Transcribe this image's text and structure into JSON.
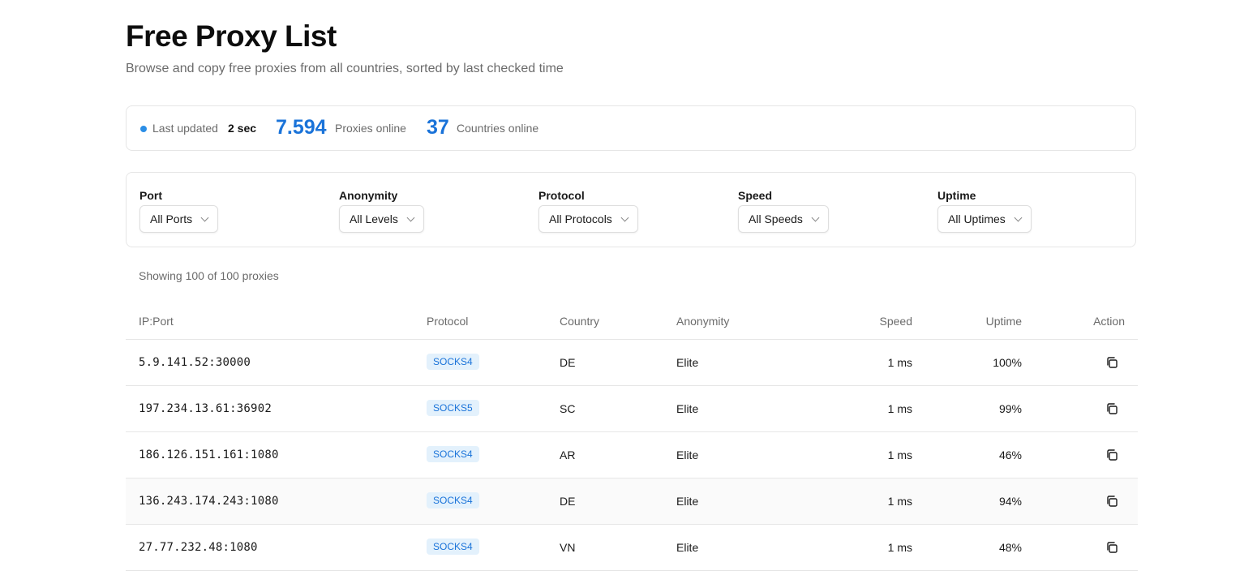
{
  "header": {
    "title": "Free Proxy List",
    "subtitle": "Browse and copy free proxies from all countries, sorted by last checked time"
  },
  "stats": {
    "last_updated_label": "Last updated",
    "last_updated_value": "2 sec",
    "proxies_count": "7.594",
    "proxies_label": "Proxies online",
    "countries_count": "37",
    "countries_label": "Countries online",
    "status_dot_color": "#2b8ee6"
  },
  "filters": {
    "port": {
      "label": "Port",
      "value": "All Ports"
    },
    "anonymity": {
      "label": "Anonymity",
      "value": "All Levels"
    },
    "protocol": {
      "label": "Protocol",
      "value": "All Protocols"
    },
    "speed": {
      "label": "Speed",
      "value": "All Speeds"
    },
    "uptime": {
      "label": "Uptime",
      "value": "All Uptimes"
    }
  },
  "showing_text": "Showing 100 of 100 proxies",
  "table": {
    "columns": {
      "ip_port": "IP:Port",
      "protocol": "Protocol",
      "country": "Country",
      "anonymity": "Anonymity",
      "speed": "Speed",
      "uptime": "Uptime",
      "action": "Action"
    },
    "rows": [
      {
        "ip_port": "5.9.141.52:30000",
        "protocol": "SOCKS4",
        "country": "DE",
        "anonymity": "Elite",
        "speed": "1 ms",
        "uptime": "100%",
        "action_icon": "copy-icon"
      },
      {
        "ip_port": "197.234.13.61:36902",
        "protocol": "SOCKS5",
        "country": "SC",
        "anonymity": "Elite",
        "speed": "1 ms",
        "uptime": "99%",
        "action_icon": "copy-icon"
      },
      {
        "ip_port": "186.126.151.161:1080",
        "protocol": "SOCKS4",
        "country": "AR",
        "anonymity": "Elite",
        "speed": "1 ms",
        "uptime": "46%",
        "action_icon": "copy-icon"
      },
      {
        "ip_port": "136.243.174.243:1080",
        "protocol": "SOCKS4",
        "country": "DE",
        "anonymity": "Elite",
        "speed": "1 ms",
        "uptime": "94%",
        "action_icon": "copy-icon"
      },
      {
        "ip_port": "27.77.232.48:1080",
        "protocol": "SOCKS4",
        "country": "VN",
        "anonymity": "Elite",
        "speed": "1 ms",
        "uptime": "48%",
        "action_icon": "copy-icon"
      }
    ]
  },
  "colors": {
    "accent": "#1a73d9",
    "badge_bg": "#e3f1fc",
    "border": "#e6e6e6",
    "muted_text": "#6b6b6b",
    "hover_row_bg": "#fafafa"
  }
}
